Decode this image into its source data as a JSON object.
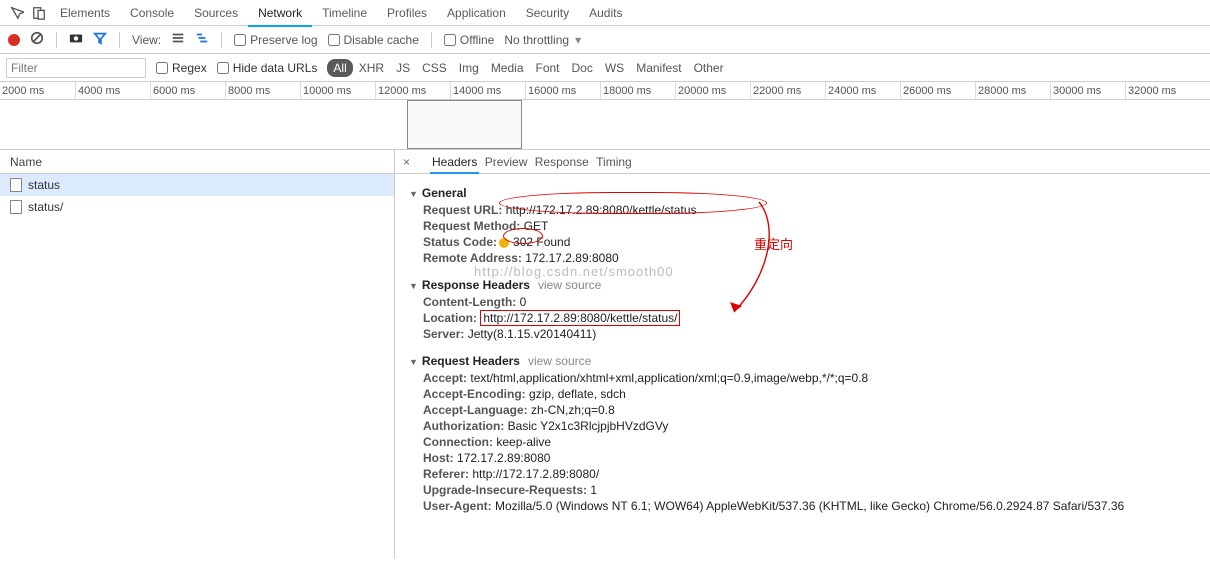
{
  "tabs": {
    "items": [
      "Elements",
      "Console",
      "Sources",
      "Network",
      "Timeline",
      "Profiles",
      "Application",
      "Security",
      "Audits"
    ],
    "active": 3
  },
  "toolbar": {
    "view_label": "View:",
    "preserve_log": "Preserve log",
    "disable_cache": "Disable cache",
    "offline": "Offline",
    "throttling": "No throttling"
  },
  "filter": {
    "placeholder": "Filter",
    "regex": "Regex",
    "hide_data_urls": "Hide data URLs",
    "types": [
      "All",
      "XHR",
      "JS",
      "CSS",
      "Img",
      "Media",
      "Font",
      "Doc",
      "WS",
      "Manifest",
      "Other"
    ],
    "active_type": 0
  },
  "ruler": [
    "2000 ms",
    "4000 ms",
    "6000 ms",
    "8000 ms",
    "10000 ms",
    "12000 ms",
    "14000 ms",
    "16000 ms",
    "18000 ms",
    "20000 ms",
    "22000 ms",
    "24000 ms",
    "26000 ms",
    "28000 ms",
    "30000 ms",
    "32000 ms"
  ],
  "request_list": {
    "header": "Name",
    "rows": [
      "status",
      "status/"
    ],
    "selected": 0
  },
  "detail_tabs": {
    "items": [
      "Headers",
      "Preview",
      "Response",
      "Timing"
    ],
    "active": 0
  },
  "headers": {
    "general": {
      "title": "General",
      "request_url_label": "Request URL:",
      "request_url": "http://172.17.2.89:8080/kettle/status",
      "method_label": "Request Method:",
      "method": "GET",
      "status_label": "Status Code:",
      "status": "302 Found",
      "remote_label": "Remote Address:",
      "remote": "172.17.2.89:8080"
    },
    "response": {
      "title": "Response Headers",
      "view_source": "view source",
      "content_length_label": "Content-Length:",
      "content_length": "0",
      "location_label": "Location:",
      "location": "http://172.17.2.89:8080/kettle/status/",
      "server_label": "Server:",
      "server": "Jetty(8.1.15.v20140411)"
    },
    "request": {
      "title": "Request Headers",
      "view_source": "view source",
      "accept_label": "Accept:",
      "accept": "text/html,application/xhtml+xml,application/xml;q=0.9,image/webp,*/*;q=0.8",
      "accept_encoding_label": "Accept-Encoding:",
      "accept_encoding": "gzip, deflate, sdch",
      "accept_language_label": "Accept-Language:",
      "accept_language": "zh-CN,zh;q=0.8",
      "authorization_label": "Authorization:",
      "authorization": "Basic Y2x1c3RlcjpjbHVzdGVy",
      "connection_label": "Connection:",
      "connection": "keep-alive",
      "host_label": "Host:",
      "host": "172.17.2.89:8080",
      "referer_label": "Referer:",
      "referer": "http://172.17.2.89:8080/",
      "upgrade_label": "Upgrade-Insecure-Requests:",
      "upgrade": "1",
      "ua_label": "User-Agent:",
      "ua": "Mozilla/5.0 (Windows NT 6.1; WOW64) AppleWebKit/537.36 (KHTML, like Gecko) Chrome/56.0.2924.87 Safari/537.36"
    }
  },
  "annotations": {
    "redirect": "重定向",
    "watermark": "http://blog.csdn.net/smooth00"
  }
}
